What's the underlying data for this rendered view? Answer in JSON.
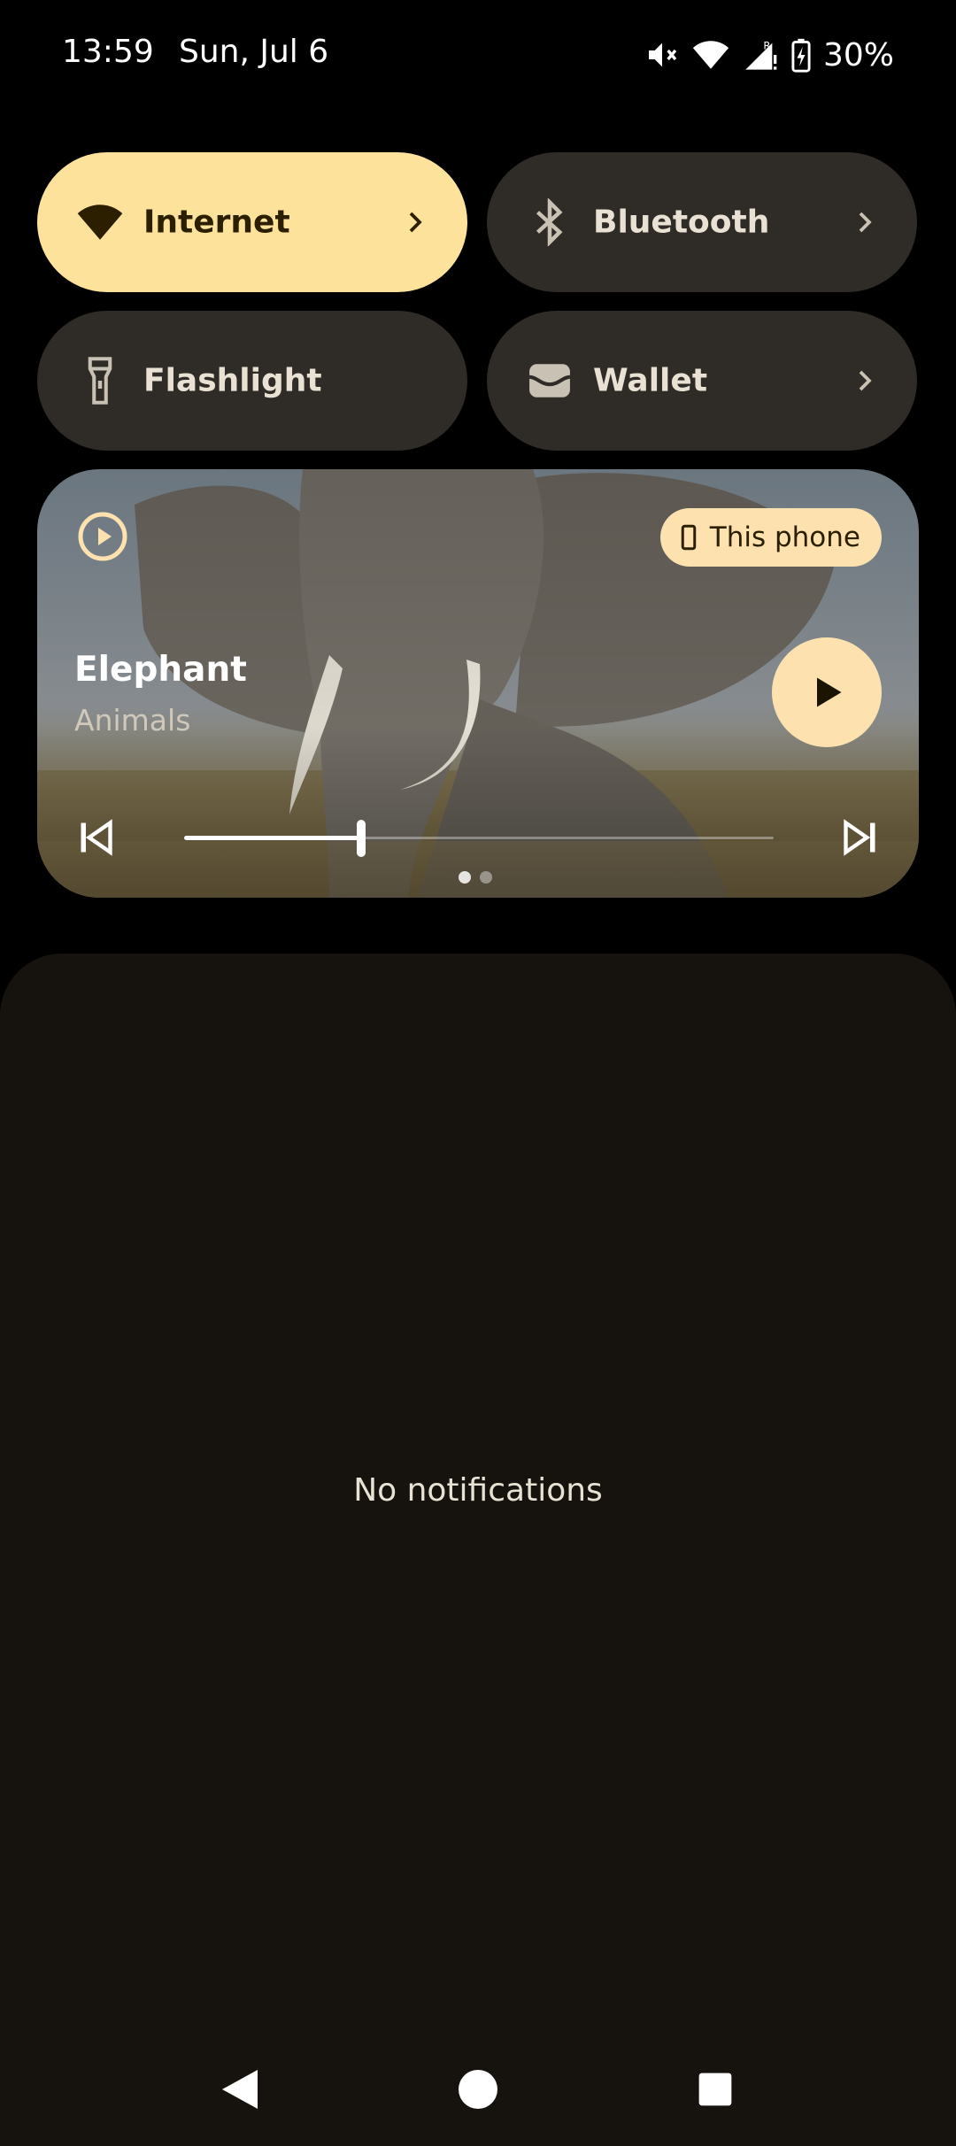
{
  "status_bar": {
    "time": "13:59",
    "date": "Sun, Jul 6",
    "battery": "30%",
    "icons": [
      "mute-icon",
      "wifi-icon",
      "signal-roaming-icon",
      "battery-charging-icon"
    ]
  },
  "quick_settings": {
    "tiles": [
      {
        "label": "Internet",
        "icon": "wifi-icon",
        "active": true,
        "has_chevron": true
      },
      {
        "label": "Bluetooth",
        "icon": "bluetooth-icon",
        "active": false,
        "has_chevron": true
      },
      {
        "label": "Flashlight",
        "icon": "flashlight-icon",
        "active": false,
        "has_chevron": false
      },
      {
        "label": "Wallet",
        "icon": "wallet-icon",
        "active": false,
        "has_chevron": true
      }
    ]
  },
  "media": {
    "title": "Elephant",
    "artist": "Animals",
    "output_device": "This phone",
    "progress": 0.3,
    "pages": 2,
    "current_page": 1
  },
  "notifications": {
    "empty_text": "No notifications"
  },
  "colors": {
    "active_tile": "#fde29b",
    "inactive_tile": "#2f2b26",
    "panel": "#16130e",
    "accent_chip": "#fde2b0"
  }
}
